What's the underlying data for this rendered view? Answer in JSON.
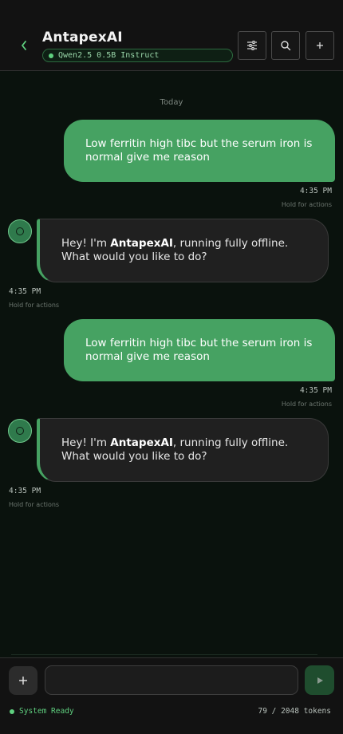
{
  "header": {
    "title": "AntapexAI",
    "model": "Qwen2.5 0.5B Instruct",
    "back_icon": "chevron-left-icon",
    "buttons": [
      "sliders-icon",
      "search-icon",
      "plus-icon"
    ]
  },
  "chat": {
    "date_label": "Today",
    "messages": [
      {
        "role": "user",
        "text": "Low ferritin high tibc but the serum iron is normal give me reason",
        "time": "4:35 PM",
        "hint": "Hold for actions"
      },
      {
        "role": "assistant",
        "prefix": "Hey! I'm ",
        "bold": "AntapexAI",
        "suffix": ", running fully offline. What would you like to do?",
        "time": "4:35 PM",
        "hint": "Hold for actions"
      },
      {
        "role": "user",
        "text": "Low ferritin high tibc but the serum iron is normal give me reason",
        "time": "4:35 PM",
        "hint": "Hold for actions"
      },
      {
        "role": "assistant",
        "prefix": "Hey! I'm ",
        "bold": "AntapexAI",
        "suffix": ", running fully offline. What would you like to do?",
        "time": "4:35 PM",
        "hint": "Hold for actions"
      }
    ]
  },
  "composer": {
    "input_value": "",
    "add_icon": "plus-icon",
    "send_icon": "send-icon"
  },
  "status": {
    "text": "System Ready",
    "tokens": "79 / 2048 tokens"
  },
  "colors": {
    "accent": "#46a262",
    "background": "#0a120d",
    "status_green": "#5fd07f"
  }
}
